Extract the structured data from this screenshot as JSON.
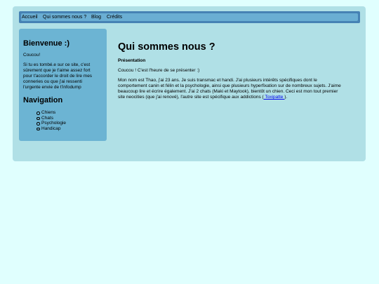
{
  "nav": {
    "items": [
      "Accueil",
      "Qui sommes nous ?",
      "Blog",
      "Crédits"
    ]
  },
  "sidebar": {
    "welcome_title": "Bienvenue :)",
    "greeting": "Coucou!",
    "intro_lines": [
      "Si tu es tombé.e sur ce site, c'est",
      "sûrement que je t'aime assez fort",
      "pour t'accorder le droit de lire mes",
      "conneries ou que j'ai ressenti",
      "l'urgente envie de t'infodump"
    ],
    "nav_title": "Navigation",
    "nav_items": [
      "Chiens",
      "Chats",
      "Psychologie",
      "Handicap"
    ]
  },
  "main": {
    "title": "Qui sommes nous ?",
    "subtitle": "Présentation",
    "intro": "Coucou ! C'est l'heure de se présenter :)",
    "body_lines": [
      "Mon nom est Thao, j'ai 23 ans. Je suis transmac et handi. J'ai plusieurs intérêts spécifiques dont le",
      "comportement canin et félin et la psychologie, ainsi que plusieurs hyperfixation sur de nombreux sujets. J'aime",
      "beaucoup lire et écrire également. J'ai 2 chats (Maki et Maytook), bientôt un chien. Ceci est mon tout premier"
    ],
    "last_line_before": "site neocities (que j'ai renové), l'autre site est spécifique aux addictions (",
    "last_line_link": " Toxipatte ",
    "last_line_after": ")."
  },
  "colors": {
    "page_bg": "#e0fffe",
    "frame_bg": "#b0e0e6",
    "navbar_border": "#4682b4",
    "navbar_fill": "#6aaed3",
    "sidebar_bg": "#6cb4d3",
    "link": "#0000ee"
  }
}
